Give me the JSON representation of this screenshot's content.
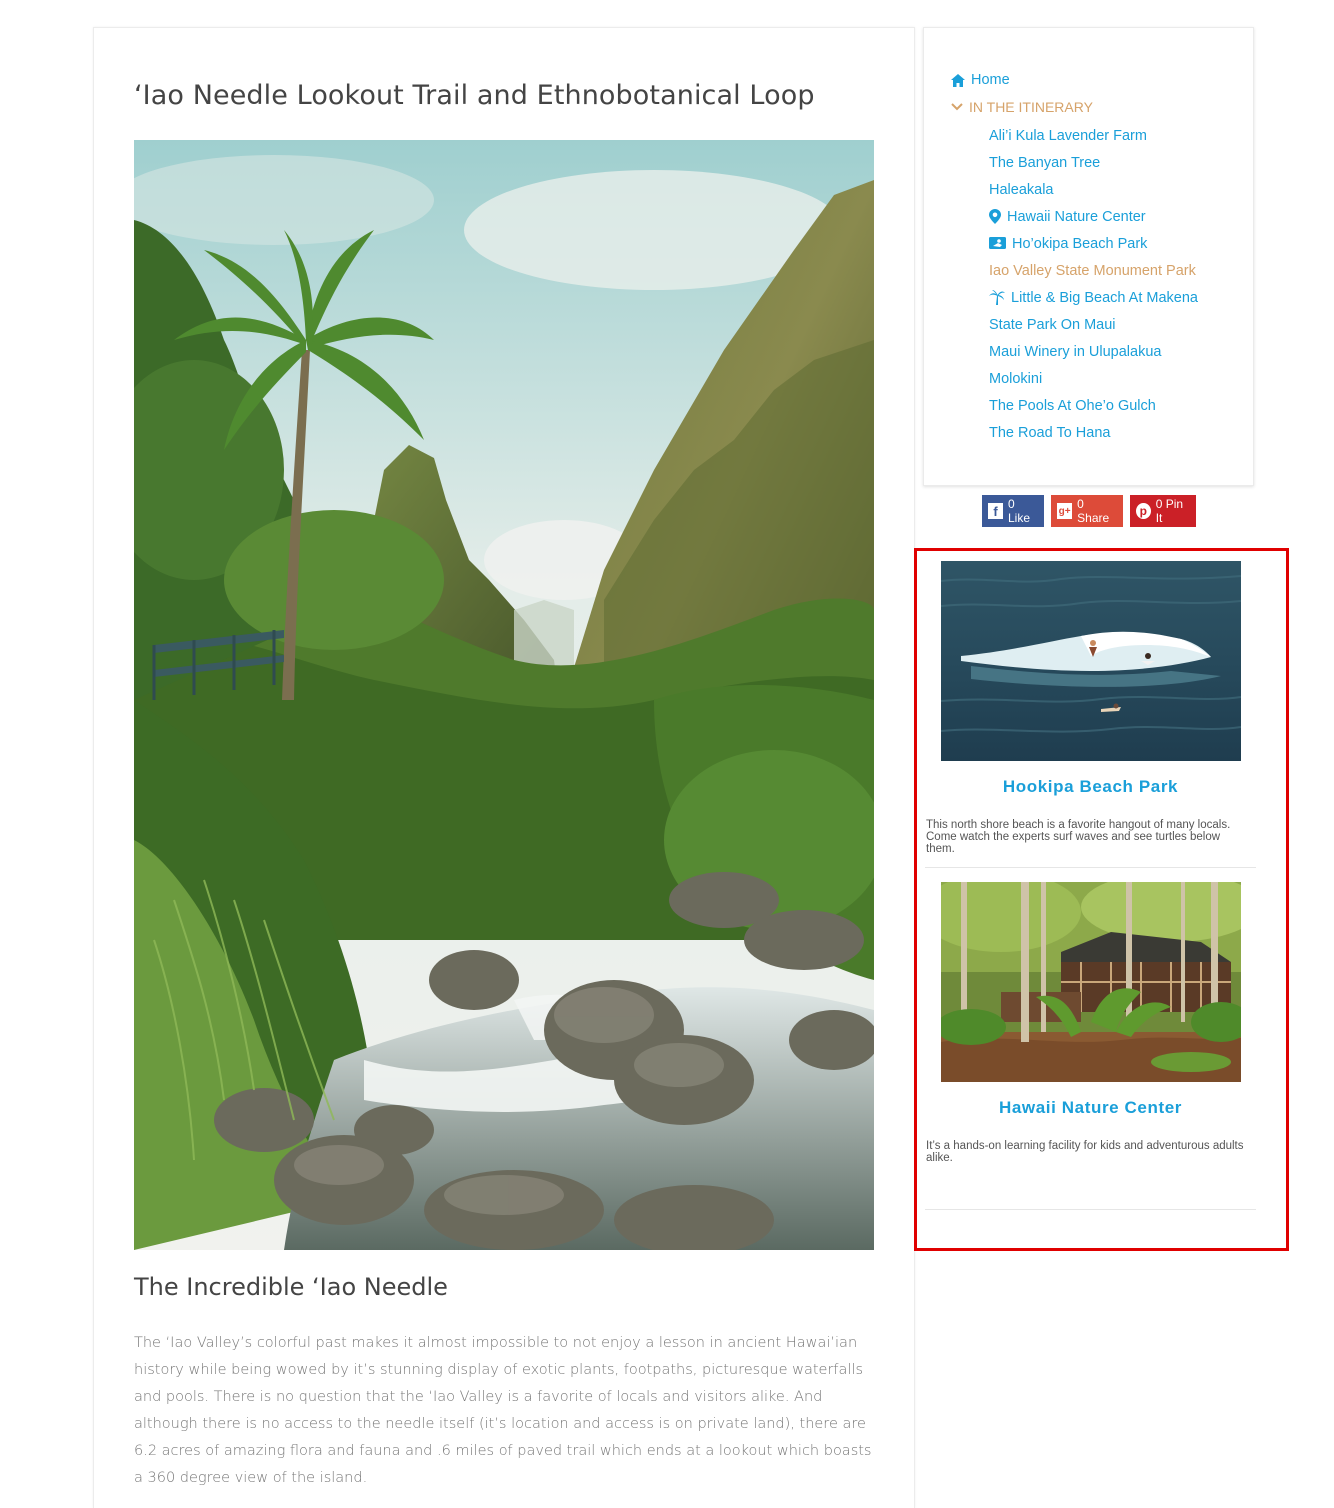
{
  "article": {
    "title": "‘Iao Needle Lookout Trail and Ethnobotanical Loop",
    "section_title": "The Incredible ‘Iao Needle",
    "body": "The ‘Iao Valley’s colorful past makes it almost impossible to not enjoy a lesson in ancient Hawai’ian history while being wowed by it’s stunning display of exotic plants, footpaths, picturesque waterfalls and pools. There is no question that the ‘Iao Valley is a favorite of locals and visitors alike. And although there is no access to the needle itself (it’s location and access is on private land), there are 6.2 acres of amazing flora and fauna and .6 miles of paved trail which ends at a lookout which boasts a 360 degree view of the island."
  },
  "sidebar": {
    "home_label": "Home",
    "section_label": "IN THE ITINERARY",
    "items": [
      {
        "label": "Ali’i Kula Lavender Farm",
        "icon": "",
        "current": false
      },
      {
        "label": "The Banyan Tree",
        "icon": "",
        "current": false
      },
      {
        "label": "Haleakala",
        "icon": "",
        "current": false
      },
      {
        "label": "Hawaii Nature Center",
        "icon": "map-pin-icon",
        "current": false
      },
      {
        "label": "Ho’okipa Beach Park",
        "icon": "surf-icon",
        "current": false
      },
      {
        "label": "Iao Valley State Monument Park",
        "icon": "",
        "current": true
      },
      {
        "label": "Little & Big Beach At Makena",
        "icon": "palm-tree-icon",
        "current": false
      },
      {
        "label": "State Park On Maui",
        "icon": "",
        "current": false
      },
      {
        "label": "Maui Winery in Ulupalakua",
        "icon": "",
        "current": false
      },
      {
        "label": "Molokini",
        "icon": "",
        "current": false
      },
      {
        "label": "The Pools At Ohe’o Gulch",
        "icon": "",
        "current": false
      },
      {
        "label": "The Road To Hana",
        "icon": "",
        "current": false
      }
    ]
  },
  "share": {
    "like": "0 Like",
    "gplus": "0 Share",
    "pin": "0 Pin It"
  },
  "featured": [
    {
      "title": "Hookipa Beach Park",
      "description": "This north shore beach is a favorite hangout of many locals.   Come watch the experts surf waves and see turtles below them."
    },
    {
      "title": "Hawaii Nature Center",
      "description": "It’s a hands-on learning facility for kids and adventurous adults alike."
    }
  ],
  "colors": {
    "link": "#1a9fd9",
    "current": "#d6a36a",
    "highlight_border": "#e00000",
    "facebook": "#3b5998",
    "gplus": "#dd4b39",
    "pinterest": "#cb2027"
  }
}
